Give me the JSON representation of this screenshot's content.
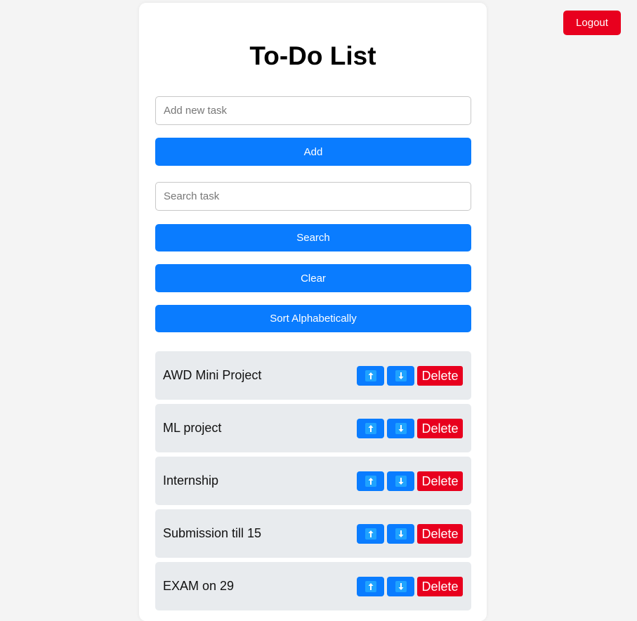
{
  "header": {
    "logout_label": "Logout"
  },
  "main": {
    "title": "To-Do List",
    "add_input": {
      "placeholder": "Add new task",
      "value": ""
    },
    "add_label": "Add",
    "search_input": {
      "placeholder": "Search task",
      "value": ""
    },
    "search_label": "Search",
    "clear_label": "Clear",
    "sort_label": "Sort Alphabetically"
  },
  "tasks": [
    {
      "text": "AWD Mini Project",
      "delete_label": "Delete"
    },
    {
      "text": "ML project",
      "delete_label": "Delete"
    },
    {
      "text": "Internship",
      "delete_label": "Delete"
    },
    {
      "text": "Submission till 15",
      "delete_label": "Delete"
    },
    {
      "text": "EXAM on 29",
      "delete_label": "Delete"
    }
  ],
  "icons": {
    "move_up": "arrow-up-icon",
    "move_down": "arrow-down-icon"
  },
  "colors": {
    "primary": "#0a7cff",
    "danger": "#e8001e",
    "background": "#f4f4f4",
    "task_background": "#e8ebee"
  }
}
